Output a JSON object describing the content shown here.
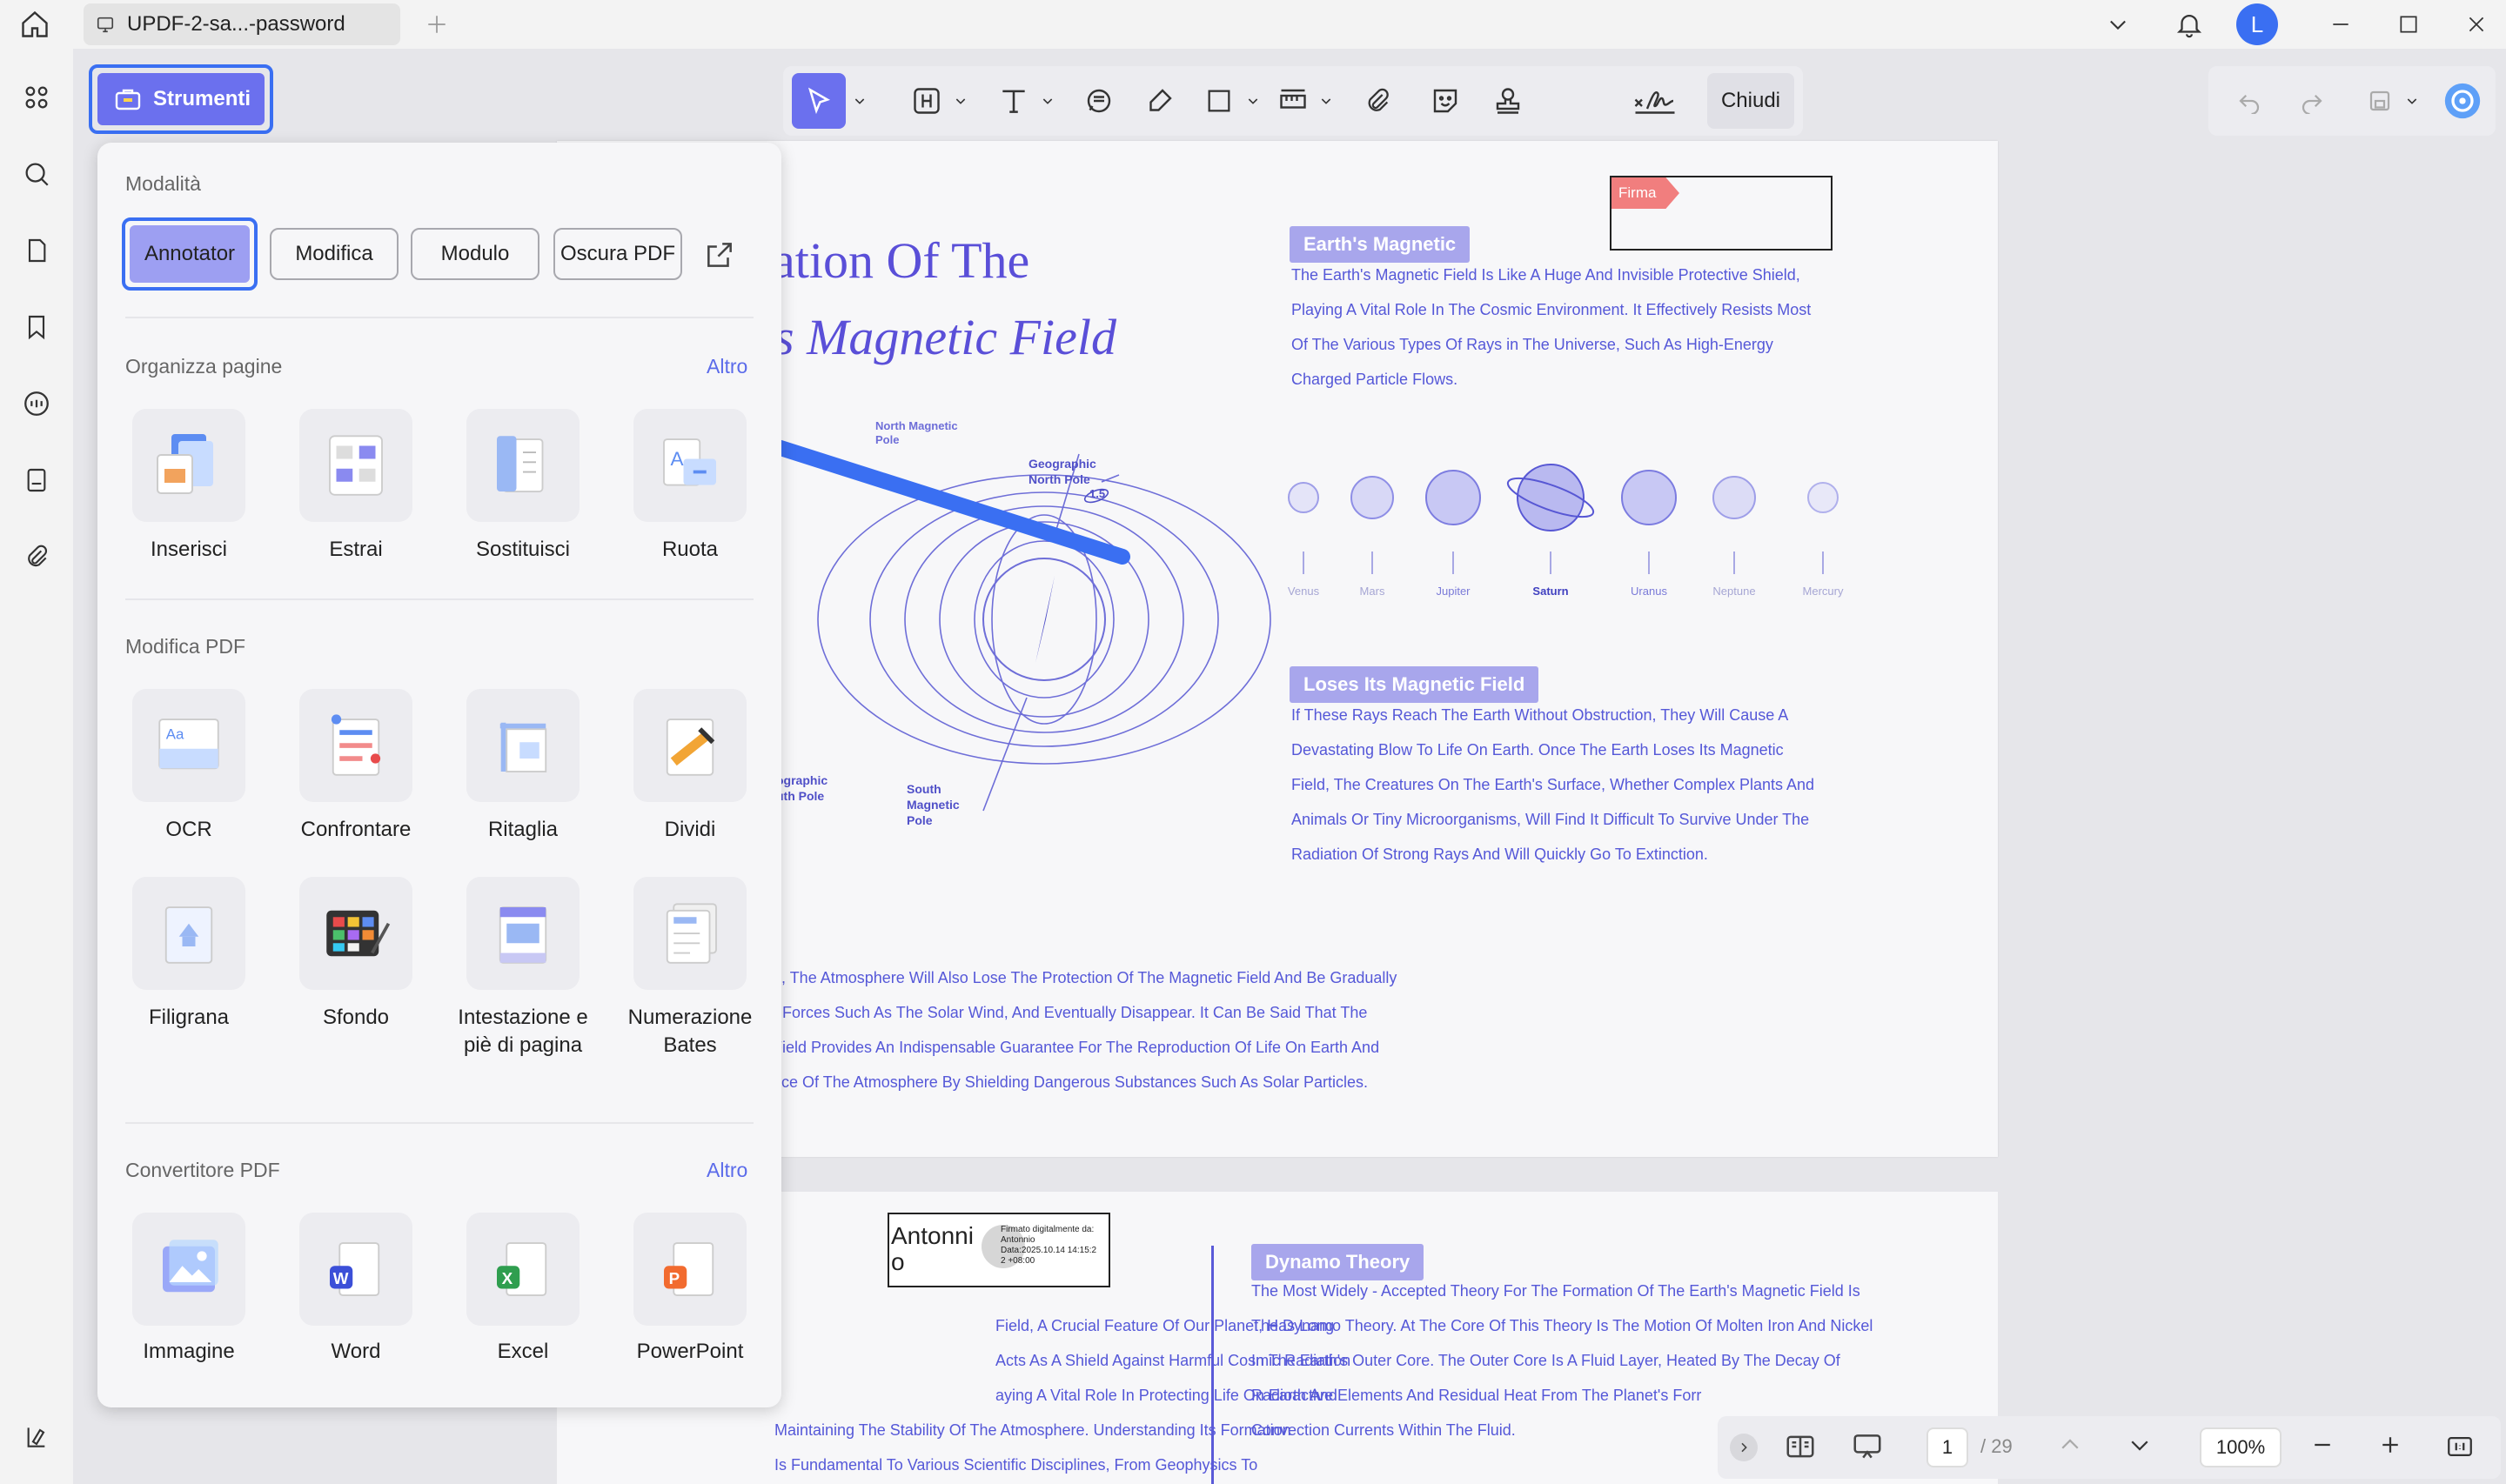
{
  "titlebar": {
    "tab_title": "UPDF-2-sa...-password",
    "avatar_letter": "L",
    "accent": "#3a6ff2"
  },
  "toolbar": {
    "tools_label": "Strumenti",
    "close_label": "Chiudi"
  },
  "panel": {
    "mode_heading": "Modalità",
    "modes": [
      "Annotator",
      "Modifica",
      "Modulo",
      "Oscura PDF"
    ],
    "organize": {
      "heading": "Organizza pagine",
      "more": "Altro",
      "items": [
        "Inserisci",
        "Estrai",
        "Sostituisci",
        "Ruota"
      ]
    },
    "edit": {
      "heading": "Modifica PDF",
      "items": [
        "OCR",
        "Confrontare",
        "Ritaglia",
        "Dividi",
        "Filigrana",
        "Sfondo",
        "Intestazione e piè di pagina",
        "Numerazione Bates"
      ]
    },
    "convert": {
      "heading": "Convertitore PDF",
      "more": "Altro",
      "items": [
        "Immagine",
        "Word",
        "Excel",
        "PowerPoint"
      ]
    }
  },
  "doc": {
    "title_line1": "ation Of The",
    "title_line2": "s Magnetic Field",
    "signature_tag": "Firma",
    "badge1": "Earth's Magnetic",
    "para1": [
      "The Earth's Magnetic Field Is Like A Huge And Invisible Protective Shield,",
      "Playing A Vital Role In The Cosmic Environment. It Effectively Resists Most",
      "Of The Various Types Of Rays in The Universe, Such As High-Energy",
      "Charged Particle Flows."
    ],
    "planets": [
      "Venus",
      "Mars",
      "Jupiter",
      "Saturn",
      "Uranus",
      "Neptune",
      "Mercury"
    ],
    "badge2": "Loses Its Magnetic Field",
    "para2": [
      "If These Rays Reach The Earth Without Obstruction, They Will Cause A",
      "Devastating Blow To Life On Earth. Once The Earth Loses Its Magnetic",
      "Field, The Creatures On The Earth's Surface, Whether Complex Plants And",
      "Animals Or Tiny Microorganisms, Will Find It Difficult To Survive Under The",
      "Radiation Of Strong Rays And Will Quickly Go To Extinction."
    ],
    "para3": [
      "e, The Atmosphere Will Also Lose The Protection Of The Magnetic Field And Be Gradually",
      "r Forces Such As The Solar Wind, And Eventually Disappear. It Can Be Said That The",
      "Field Provides An Indispensable Guarantee For The Reproduction Of Life On Earth And",
      "nce Of The Atmosphere By Shielding Dangerous Substances Such As Solar Particles."
    ],
    "diagram_labels": {
      "north_mag": "North Magnetic Pole",
      "geo_north": "Geographic North Pole",
      "geo_south": "ographic uth Pole",
      "south_mag": "South Magnetic Pole",
      "angle": "1.5"
    },
    "sig_name_l1": "Antonni",
    "sig_name_l2": "o",
    "sig_text": [
      "Firmato digitalmente da:",
      "Antonnio",
      "Data:2025.10.14 14:15:2",
      "2 +08:00"
    ],
    "para4": [
      "Field, A Crucial Feature Of Our Planet, Has Long",
      "Acts As A Shield Against Harmful Cosmic Radiation",
      "aying A Vital Role In Protecting Life On Earth And",
      "Maintaining The Stability Of The Atmosphere. Understanding Its Formation",
      "Is Fundamental To Various Scientific Disciplines, From Geophysics To"
    ],
    "badge3": "Dynamo Theory",
    "para5": [
      "The Most Widely - Accepted Theory For The Formation Of The Earth's Magnetic Field Is",
      "The Dynamo Theory. At The Core Of This Theory Is The Motion Of Molten Iron And Nickel",
      "In The Earth's Outer Core. The Outer Core Is A Fluid Layer, Heated By The Decay Of",
      "Radioactive Elements And Residual Heat From The Planet's Forr",
      "Convection Currents Within The Fluid."
    ]
  },
  "nav": {
    "page_current": "1",
    "page_total": "/ 29",
    "zoom": "100%"
  }
}
